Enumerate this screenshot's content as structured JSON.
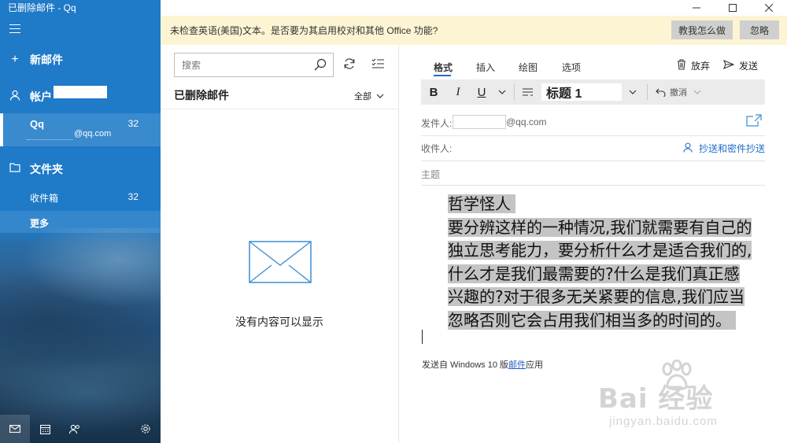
{
  "window": {
    "title": "已删除邮件 - Qq"
  },
  "sidebar": {
    "new_mail": "新邮件",
    "accounts_label": "帐户",
    "account": {
      "name": "Qq",
      "count": "32",
      "email_suffix": "@qq.com"
    },
    "folders_label": "文件夹",
    "folders": [
      {
        "label": "收件箱",
        "count": "32"
      },
      {
        "label": "更多"
      }
    ]
  },
  "notification": {
    "message": "未检查英语(美国)文本。是否要为其启用校对和其他 Office 功能?",
    "teach_button": "教我怎么做",
    "ignore_button": "忽略"
  },
  "list": {
    "search_placeholder": "搜索",
    "title": "已删除邮件",
    "filter": "全部",
    "empty_message": "没有内容可以显示"
  },
  "compose": {
    "tabs": [
      "格式",
      "插入",
      "绘图",
      "选项"
    ],
    "active_tab": "格式",
    "discard": "放弃",
    "send": "发送",
    "ribbon": {
      "bold": "B",
      "italic": "I",
      "underline": "U",
      "style": "标题 1",
      "undo": "撤消"
    },
    "from_label": "发件人:",
    "from_suffix": "@qq.com",
    "to_label": "收件人:",
    "cc_link": "抄送和密件抄送",
    "subject_placeholder": "主题",
    "body_lines": [
      "哲学怪人",
      "要分辨这样的一种情况,我们就需要有自己的",
      "独立思考能力，要分析什么才是适合我们的,",
      "什么才是我们最需要的?什么是我们真正感",
      "兴趣的?对于很多无关紧要的信息,我们应当",
      "忽略否则它会占用我们相当多的时间的。"
    ],
    "signature_prefix": "发送自 Windows 10 版",
    "signature_link": "邮件",
    "signature_suffix": "应用"
  },
  "watermark": {
    "brand": "Bai 经验",
    "url": "jingyan.baidu.com"
  }
}
